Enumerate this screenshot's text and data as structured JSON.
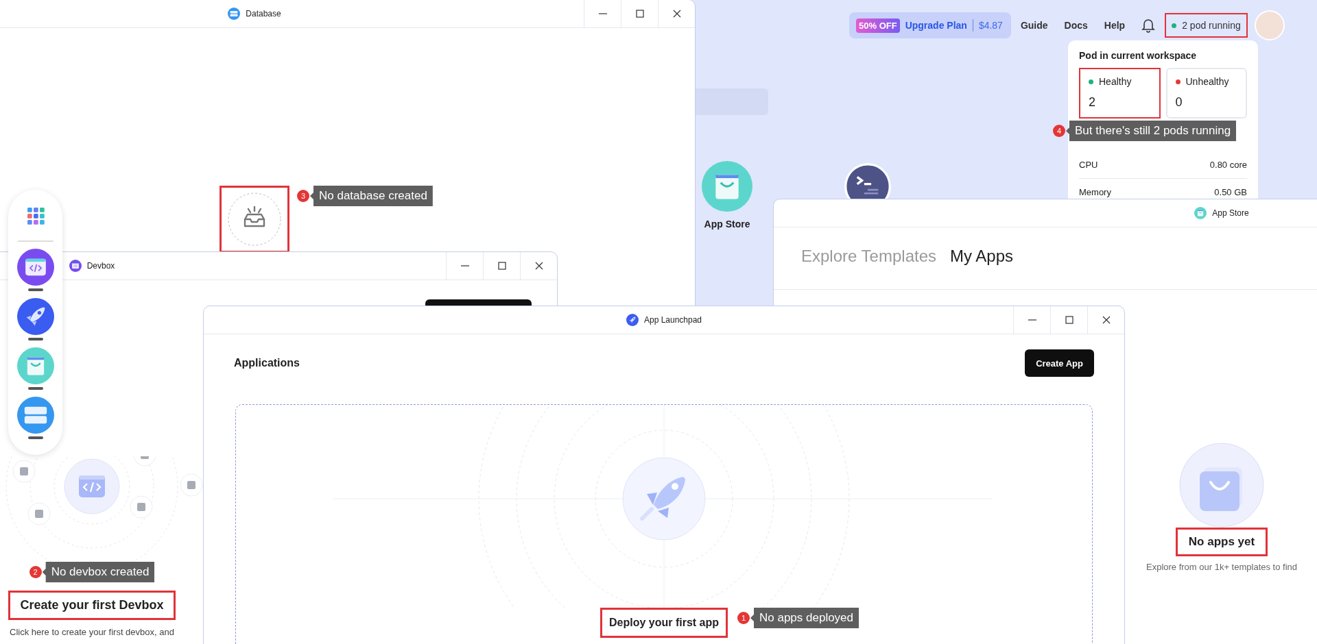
{
  "top_bar": {
    "promo": {
      "badge": "50% OFF",
      "label": "Upgrade Plan",
      "price": "$4.87"
    },
    "links": [
      "Guide",
      "Docs",
      "Help"
    ],
    "pod_status": {
      "label": "2 pod running",
      "color": "#1db47a",
      "highlighted": true
    }
  },
  "pod_popover": {
    "title": "Pod in current workspace",
    "cards": [
      {
        "label": "Healthy",
        "value": "2",
        "color": "#1db47a",
        "highlighted": true
      },
      {
        "label": "Unhealthy",
        "value": "0",
        "color": "#e53935",
        "highlighted": false
      }
    ],
    "annotation": {
      "number": "4",
      "text": "But there's still 2 pods running"
    },
    "usage": [
      {
        "label": "CPU",
        "value": "0.80 core"
      },
      {
        "label": "Memory",
        "value": "0.50 GB"
      }
    ]
  },
  "desktop_icons": [
    {
      "kind": "store",
      "label": "App Store"
    },
    {
      "kind": "terminal"
    }
  ],
  "database_window": {
    "title": "Database",
    "empty_highlighted": true,
    "annotation": {
      "number": "3",
      "text": "No database created"
    }
  },
  "app_store_window": {
    "title": "App Store",
    "tabs": [
      {
        "label": "Explore Templates",
        "selected": false
      },
      {
        "label": "My Apps",
        "selected": true
      }
    ],
    "empty_title": "No apps yet",
    "empty_highlighted": true,
    "empty_hint": "Explore from our 1k+ templates to find"
  },
  "devbox_window": {
    "title": "Devbox",
    "annotation": {
      "number": "2",
      "text": "No devbox created"
    },
    "heading": "Create your first Devbox",
    "heading_highlighted": true,
    "description": "Click here to create your first devbox, and"
  },
  "launchpad_window": {
    "title": "App Launchpad",
    "heading": "Applications",
    "create_button": "Create App",
    "empty_title": "Deploy your first app",
    "empty_highlighted": true,
    "annotation": {
      "number": "1",
      "text": "No apps deployed"
    }
  },
  "dock": {
    "items": [
      {
        "kind": "grid"
      },
      {
        "kind": "devbox",
        "running": true
      },
      {
        "kind": "launchpad",
        "running": true
      },
      {
        "kind": "store",
        "running": true
      },
      {
        "kind": "database",
        "running": true
      }
    ]
  }
}
